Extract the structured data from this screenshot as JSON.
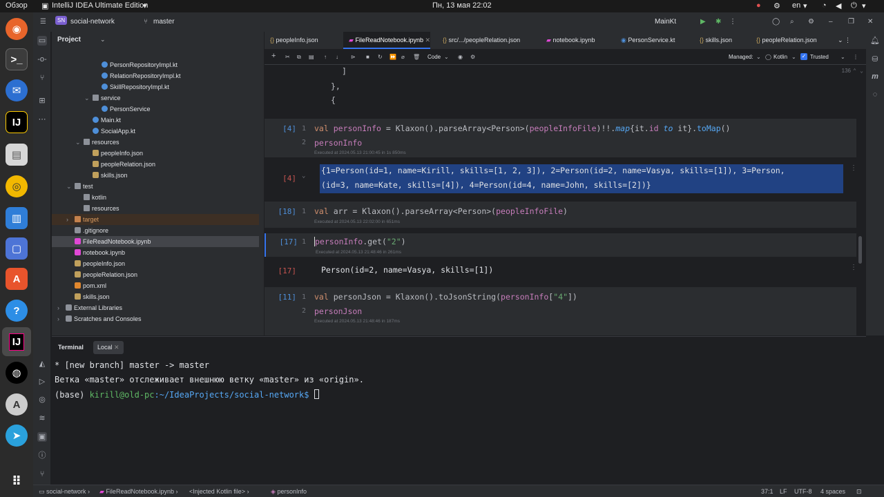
{
  "gnome": {
    "activities": "Обзор",
    "app": "IntelliJ IDEA Ultimate Edition",
    "datetime": "Пн, 13 мая  22:02",
    "lang": "en"
  },
  "topbar": {
    "project_badge": "SN",
    "project": "social-network",
    "branch": "master",
    "run_config": "MainKt"
  },
  "project_panel": {
    "title": "Project",
    "tree": [
      {
        "label": "PersonRepositoryImpl.kt",
        "indent": 4,
        "kind": "kt"
      },
      {
        "label": "RelationRepositoryImpl.kt",
        "indent": 4,
        "kind": "kt"
      },
      {
        "label": "SkillRepositoryImpl.kt",
        "indent": 4,
        "kind": "kt"
      },
      {
        "label": "service",
        "indent": 3,
        "kind": "dir",
        "open": true
      },
      {
        "label": "PersonService",
        "indent": 4,
        "kind": "kt"
      },
      {
        "label": "Main.kt",
        "indent": 3,
        "kind": "kt"
      },
      {
        "label": "SocialApp.kt",
        "indent": 3,
        "kind": "kt"
      },
      {
        "label": "resources",
        "indent": 2,
        "kind": "dir",
        "open": true
      },
      {
        "label": "peopleInfo.json",
        "indent": 3,
        "kind": "json"
      },
      {
        "label": "peopleRelation.json",
        "indent": 3,
        "kind": "json"
      },
      {
        "label": "skills.json",
        "indent": 3,
        "kind": "json"
      },
      {
        "label": "test",
        "indent": 1,
        "kind": "dir",
        "open": true
      },
      {
        "label": "kotlin",
        "indent": 2,
        "kind": "dir"
      },
      {
        "label": "resources",
        "indent": 2,
        "kind": "dir"
      },
      {
        "label": "target",
        "indent": 1,
        "kind": "dirorange",
        "open": false
      },
      {
        "label": ".gitignore",
        "indent": 1,
        "kind": "file"
      },
      {
        "label": "FileReadNotebook.ipynb",
        "indent": 1,
        "kind": "nb",
        "selected": true
      },
      {
        "label": "notebook.ipynb",
        "indent": 1,
        "kind": "nb"
      },
      {
        "label": "peopleInfo.json",
        "indent": 1,
        "kind": "json"
      },
      {
        "label": "peopleRelation.json",
        "indent": 1,
        "kind": "json"
      },
      {
        "label": "pom.xml",
        "indent": 1,
        "kind": "xml"
      },
      {
        "label": "skills.json",
        "indent": 1,
        "kind": "json"
      },
      {
        "label": "External Libraries",
        "indent": 0,
        "kind": "lib",
        "open": false
      },
      {
        "label": "Scratches and Consoles",
        "indent": 0,
        "kind": "scratch",
        "open": false
      }
    ]
  },
  "tabs": [
    "peopleInfo.json",
    "FileReadNotebook.ipynb",
    "src/.../peopleRelation.json",
    "notebook.ipynb",
    "PersonService.kt",
    "skills.json",
    "peopleRelation.json"
  ],
  "nb_toolbar": {
    "cell_type": "Code",
    "managed": "Managed:",
    "kernel": "Kotlin",
    "trusted": "Trusted",
    "counter": "136"
  },
  "code": {
    "top_lines": [
      "]",
      "},",
      "{"
    ],
    "cell1": {
      "num": "[4]",
      "line1_num": "1",
      "line2_num": "2",
      "line2": "personInfo",
      "exec": "Executed at 2024.05.13 21:00:45 in 1s 850ms"
    },
    "out1": {
      "num": "[4]",
      "line1": "{1=Person(id=1, name=Kirill, skills=[1, 2, 3]), 2=Person(id=2, name=Vasya, skills=[1]), 3=Person,",
      "line2": "(id=3, name=Kate, skills=[4]), 4=Person(id=4, name=John, skills=[2])}"
    },
    "cell2": {
      "num": "[18]",
      "line_num": "1",
      "exec": "Executed at 2024.05.13 22:02:00 in 651ms"
    },
    "cell3": {
      "num": "[17]",
      "line_num": "1",
      "exec": "Executed at 2024.05.13 21:48:46 in 261ms"
    },
    "out3": {
      "num": "[17]",
      "text": "Person(id=2, name=Vasya, skills=[1])"
    },
    "cell4": {
      "num": "[11]",
      "line1_num": "1",
      "line2_num": "2",
      "line2": "personJson",
      "exec": "Executed at 2024.05.13 21:48:46 in 187ms"
    }
  },
  "terminal": {
    "tab": "Terminal",
    "session": "Local",
    "line1": " * [new branch]      master -> master",
    "line2": "Ветка «master» отслеживает внешнюю ветку «master» из «origin».",
    "prompt_base": "(base) ",
    "prompt_user": "kirill@old-pc",
    "prompt_path": ":~/IdeaProjects/social-network$ "
  },
  "status": {
    "crumbs": [
      "social-network",
      "FileReadNotebook.ipynb",
      "<Injected Kotlin file>",
      "personInfo"
    ],
    "pos": "37:1",
    "eol": "LF",
    "enc": "UTF-8",
    "indent": "4 spaces"
  },
  "colors": {
    "accent": "#3574f0",
    "bg": "#1e1f22",
    "panel": "#2b2d30",
    "selection": "#214283"
  }
}
